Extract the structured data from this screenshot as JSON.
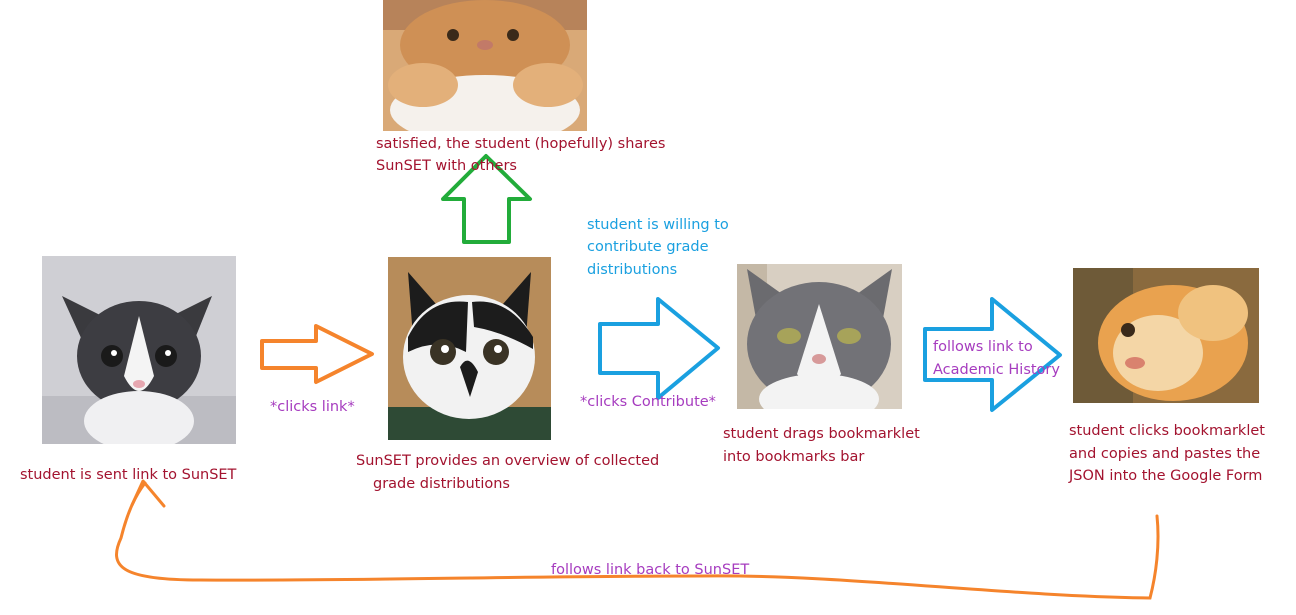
{
  "steps": {
    "sent_link": "student is sent link to SunSET",
    "overview_line1": "SunSET provides an overview of collected",
    "overview_line2": "grade distributions",
    "shares_line1": "satisfied, the student (hopefully) shares",
    "shares_line2": "SunSET with others",
    "willing_line1": "student is willing to",
    "willing_line2": "contribute grade",
    "willing_line3": "distributions",
    "drags_line1": "student drags bookmarklet",
    "drags_line2": "into bookmarks bar",
    "clicks_bm_line1": "student clicks bookmarklet",
    "clicks_bm_line2": "and copies and pastes the",
    "clicks_bm_line3": "JSON into the Google Form"
  },
  "transitions": {
    "clicks_link": "*clicks link*",
    "clicks_contribute": "*clicks Contribute*",
    "follows_academic_line1": "follows link to",
    "follows_academic_line2": "Academic History",
    "follows_back": "follows link back to SunSET"
  },
  "colors": {
    "orange": "#f5842c",
    "green": "#22ac3a",
    "blue": "#1aa0e0",
    "maroon": "#a3132f",
    "purple": "#a63cbf"
  },
  "images": {
    "kitten": "kitten-photo",
    "bicolor_cat": "bicolor-cat-photo",
    "grey_cat": "grey-white-cat-photo",
    "orange_cat_top": "orange-cat-photo",
    "blurry_cat": "blurry-orange-cat-photo"
  }
}
